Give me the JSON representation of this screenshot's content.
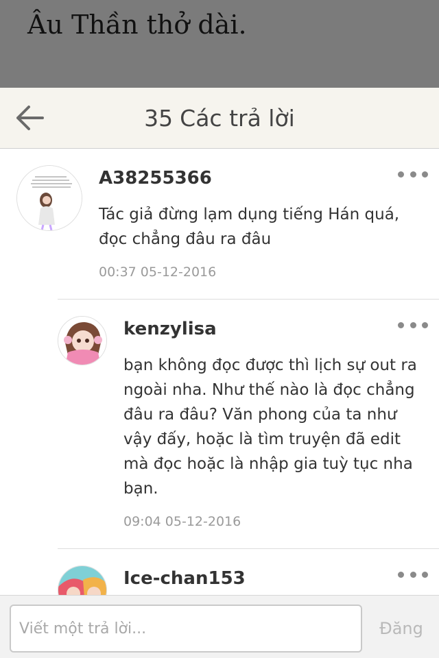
{
  "story": {
    "text": "Âu Thần thở dài."
  },
  "header": {
    "back_icon": "arrow-left-icon",
    "count": "35",
    "title": "Các trả lời"
  },
  "comments": [
    {
      "username": "A38255366",
      "body": "Tác giả đừng lạm dụng tiếng Hán quá, đọc chẳng đâu ra đâu",
      "timestamp": "00:37 05-12-2016",
      "more_icon": "more-dots-icon"
    },
    {
      "username": "kenzylisa",
      "body": "bạn không đọc được thì lịch sự out ra ngoài nha. Như thế nào là đọc chẳng đâu ra đâu? Văn phong của ta như vậy đấy, hoặc là tìm truyện đã edit mà đọc hoặc là nhập gia tuỳ tục nha bạn.",
      "timestamp": "09:04 05-12-2016",
      "more_icon": "more-dots-icon"
    },
    {
      "username": "Ice-chan153",
      "more_icon": "more-dots-icon"
    }
  ],
  "composer": {
    "placeholder": "Viết một trả lời...",
    "post_label": "Đăng"
  },
  "colors": {
    "story_strip_bg": "#7b7b7b",
    "header_bg": "#f6f4ee",
    "text_primary": "#333333",
    "text_muted": "#9a9a9a"
  }
}
